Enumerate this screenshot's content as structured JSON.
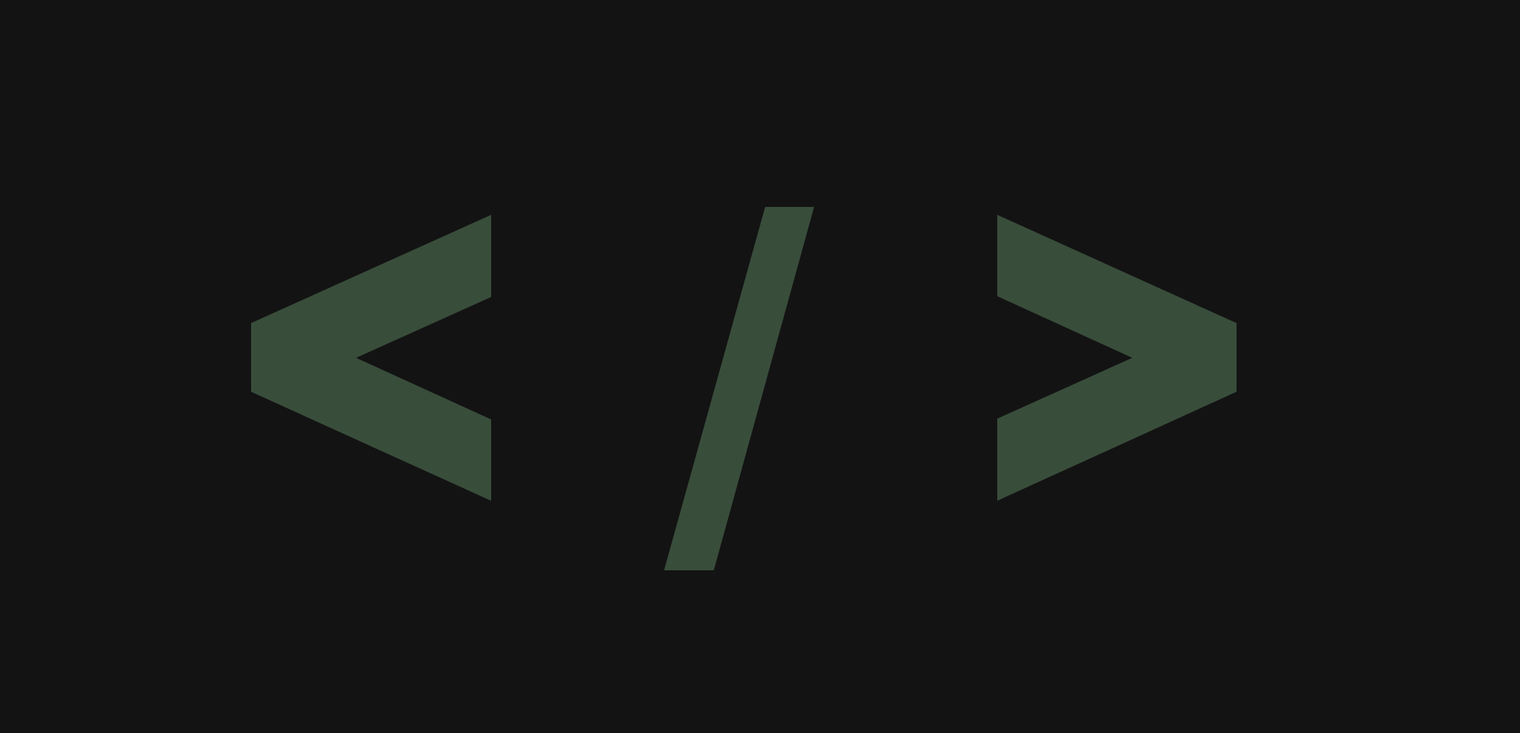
{
  "logo": {
    "text": "< / >",
    "colors": {
      "background": "#131313",
      "glyph": "#394d3b"
    }
  }
}
